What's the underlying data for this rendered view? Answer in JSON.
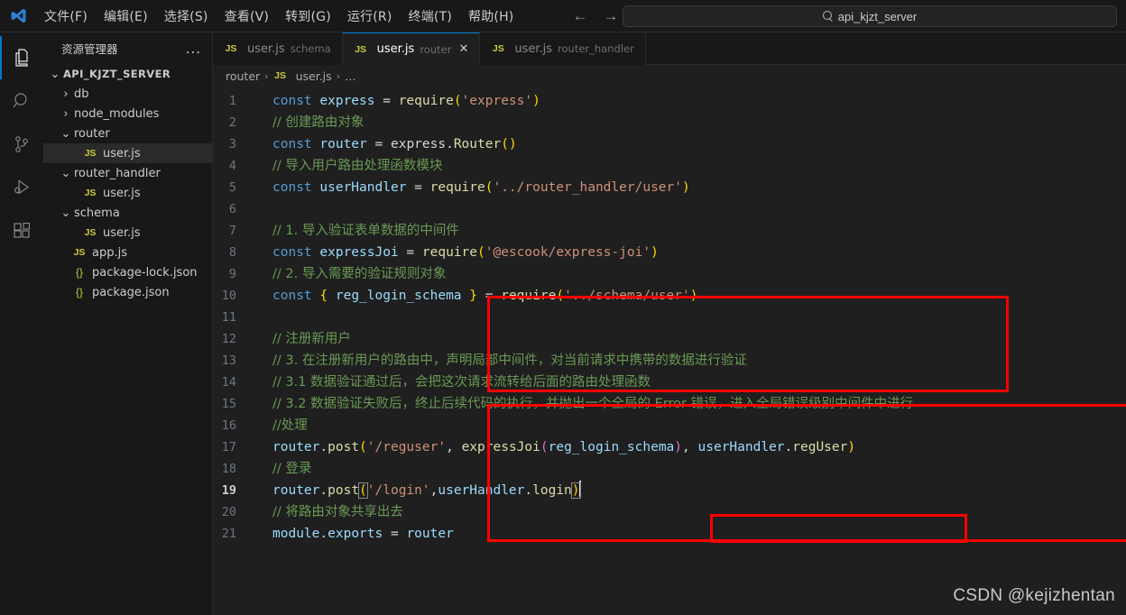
{
  "titlebar": {
    "logo_name": "vscode-logo",
    "menus": [
      "文件(F)",
      "编辑(E)",
      "选择(S)",
      "查看(V)",
      "转到(G)",
      "运行(R)",
      "终端(T)",
      "帮助(H)"
    ],
    "back_arrow": "←",
    "forward_arrow": "→",
    "quick_input": {
      "value": "api_kjzt_server",
      "icon": "search-icon"
    }
  },
  "activitybar": {
    "items": [
      {
        "name": "explorer",
        "active": true
      },
      {
        "name": "search",
        "active": false
      },
      {
        "name": "source-control",
        "active": false
      },
      {
        "name": "run-and-debug",
        "active": false
      },
      {
        "name": "extensions",
        "active": false
      }
    ]
  },
  "sidebar": {
    "title": "资源管理器",
    "more_actions": "...",
    "tree": [
      {
        "label": "API_KJZT_SERVER",
        "type": "root",
        "indent": 0,
        "chevron": "⌄",
        "selected": false
      },
      {
        "label": "db",
        "type": "folder",
        "indent": 1,
        "chevron": "›",
        "selected": false
      },
      {
        "label": "node_modules",
        "type": "folder",
        "indent": 1,
        "chevron": "›",
        "selected": false
      },
      {
        "label": "router",
        "type": "folder",
        "indent": 1,
        "chevron": "⌄",
        "selected": false
      },
      {
        "label": "user.js",
        "type": "js",
        "indent": 2,
        "chevron": "",
        "selected": true
      },
      {
        "label": "router_handler",
        "type": "folder",
        "indent": 1,
        "chevron": "⌄",
        "selected": false
      },
      {
        "label": "user.js",
        "type": "js",
        "indent": 2,
        "chevron": "",
        "selected": false
      },
      {
        "label": "schema",
        "type": "folder",
        "indent": 1,
        "chevron": "⌄",
        "selected": false
      },
      {
        "label": "user.js",
        "type": "js",
        "indent": 2,
        "chevron": "",
        "selected": false
      },
      {
        "label": "app.js",
        "type": "js",
        "indent": 1,
        "chevron": "",
        "selected": false
      },
      {
        "label": "package-lock.json",
        "type": "json",
        "indent": 1,
        "chevron": "",
        "selected": false
      },
      {
        "label": "package.json",
        "type": "json",
        "indent": 1,
        "chevron": "",
        "selected": false
      }
    ]
  },
  "tabs": [
    {
      "icon": "JS",
      "name": "user.js",
      "desc": "schema",
      "active": false,
      "close": ""
    },
    {
      "icon": "JS",
      "name": "user.js",
      "desc": "router",
      "active": true,
      "close": "✕"
    },
    {
      "icon": "JS",
      "name": "user.js",
      "desc": "router_handler",
      "active": false,
      "close": ""
    }
  ],
  "breadcrumb": {
    "folder": "router",
    "file_icon": "JS",
    "file": "user.js",
    "ellipsis": "…",
    "sep": "›"
  },
  "editor": {
    "active_line": 19,
    "lines": [
      {
        "n": 1,
        "tokens": [
          {
            "t": "const ",
            "c": "kw"
          },
          {
            "t": "express",
            "c": "var"
          },
          {
            "t": " = ",
            "c": "plain"
          },
          {
            "t": "require",
            "c": "fn"
          },
          {
            "t": "(",
            "c": "par1"
          },
          {
            "t": "'express'",
            "c": "str"
          },
          {
            "t": ")",
            "c": "par1"
          }
        ]
      },
      {
        "n": 2,
        "tokens": [
          {
            "t": "// 创建路由对象",
            "c": "cmt cmt-cjk"
          }
        ]
      },
      {
        "n": 3,
        "tokens": [
          {
            "t": "const ",
            "c": "kw"
          },
          {
            "t": "router",
            "c": "var"
          },
          {
            "t": " = ",
            "c": "plain"
          },
          {
            "t": "express",
            "c": "plain"
          },
          {
            "t": ".",
            "c": "plain"
          },
          {
            "t": "Router",
            "c": "prop"
          },
          {
            "t": "()",
            "c": "par1"
          }
        ]
      },
      {
        "n": 4,
        "tokens": [
          {
            "t": "// 导入用户路由处理函数模块",
            "c": "cmt cmt-cjk"
          }
        ]
      },
      {
        "n": 5,
        "tokens": [
          {
            "t": "const ",
            "c": "kw"
          },
          {
            "t": "userHandler",
            "c": "var"
          },
          {
            "t": " = ",
            "c": "plain"
          },
          {
            "t": "require",
            "c": "fn"
          },
          {
            "t": "(",
            "c": "par1"
          },
          {
            "t": "'../router_handler/user'",
            "c": "str"
          },
          {
            "t": ")",
            "c": "par1"
          }
        ]
      },
      {
        "n": 6,
        "tokens": []
      },
      {
        "n": 7,
        "tokens": [
          {
            "t": "// 1. 导入验证表单数据的中间件",
            "c": "cmt cmt-cjk"
          }
        ]
      },
      {
        "n": 8,
        "tokens": [
          {
            "t": "const ",
            "c": "kw"
          },
          {
            "t": "expressJoi",
            "c": "var"
          },
          {
            "t": " = ",
            "c": "plain"
          },
          {
            "t": "require",
            "c": "fn"
          },
          {
            "t": "(",
            "c": "par1"
          },
          {
            "t": "'@escook/express-joi'",
            "c": "str"
          },
          {
            "t": ")",
            "c": "par1"
          }
        ]
      },
      {
        "n": 9,
        "tokens": [
          {
            "t": "// 2. 导入需要的验证规则对象",
            "c": "cmt cmt-cjk"
          }
        ]
      },
      {
        "n": 10,
        "tokens": [
          {
            "t": "const ",
            "c": "kw"
          },
          {
            "t": "{ ",
            "c": "par1"
          },
          {
            "t": "reg_login_schema",
            "c": "var"
          },
          {
            "t": " }",
            "c": "par1"
          },
          {
            "t": " = ",
            "c": "plain"
          },
          {
            "t": "require",
            "c": "fn"
          },
          {
            "t": "(",
            "c": "par1"
          },
          {
            "t": "'../schema/user'",
            "c": "str"
          },
          {
            "t": ")",
            "c": "par1"
          }
        ]
      },
      {
        "n": 11,
        "tokens": []
      },
      {
        "n": 12,
        "tokens": [
          {
            "t": "// 注册新用户",
            "c": "cmt cmt-cjk"
          }
        ]
      },
      {
        "n": 13,
        "tokens": [
          {
            "t": "// 3. 在注册新用户的路由中，声明局部中间件，对当前请求中携带的数据进行验证",
            "c": "cmt cmt-cjk"
          }
        ]
      },
      {
        "n": 14,
        "tokens": [
          {
            "t": "// 3.1 数据验证通过后，会把这次请求流转给后面的路由处理函数",
            "c": "cmt cmt-cjk"
          }
        ]
      },
      {
        "n": 15,
        "tokens": [
          {
            "t": "// 3.2 数据验证失败后，终止后续代码的执行，并抛出一个全局的 Error 错误，进入全局错误级别中间件中进行",
            "c": "cmt cmt-cjk"
          }
        ]
      },
      {
        "n": 16,
        "tokens": [
          {
            "t": "//处理",
            "c": "cmt cmt-cjk"
          }
        ]
      },
      {
        "n": 17,
        "tokens": [
          {
            "t": "router",
            "c": "var"
          },
          {
            "t": ".",
            "c": "plain"
          },
          {
            "t": "post",
            "c": "prop"
          },
          {
            "t": "(",
            "c": "par1"
          },
          {
            "t": "'/reguser'",
            "c": "str"
          },
          {
            "t": ", ",
            "c": "plain"
          },
          {
            "t": "expressJoi",
            "c": "fn"
          },
          {
            "t": "(",
            "c": "par2"
          },
          {
            "t": "reg_login_schema",
            "c": "var"
          },
          {
            "t": ")",
            "c": "par2"
          },
          {
            "t": ", ",
            "c": "plain"
          },
          {
            "t": "userHandler",
            "c": "var"
          },
          {
            "t": ".",
            "c": "plain"
          },
          {
            "t": "regUser",
            "c": "prop"
          },
          {
            "t": ")",
            "c": "par1"
          }
        ]
      },
      {
        "n": 18,
        "tokens": [
          {
            "t": "// 登录",
            "c": "cmt cmt-cjk"
          }
        ]
      },
      {
        "n": 19,
        "tokens": [
          {
            "t": "router",
            "c": "var"
          },
          {
            "t": ".",
            "c": "plain"
          },
          {
            "t": "post",
            "c": "prop"
          },
          {
            "t": "(",
            "c": "par1 bracket-box"
          },
          {
            "t": "'/login'",
            "c": "str"
          },
          {
            "t": ",",
            "c": "plain"
          },
          {
            "t": "userHandler",
            "c": "var"
          },
          {
            "t": ".",
            "c": "plain"
          },
          {
            "t": "login",
            "c": "prop"
          },
          {
            "t": ")",
            "c": "par1 bracket-box"
          }
        ]
      },
      {
        "n": 20,
        "tokens": [
          {
            "t": "// 将路由对象共享出去",
            "c": "cmt cmt-cjk"
          }
        ]
      },
      {
        "n": 21,
        "tokens": [
          {
            "t": "module",
            "c": "var"
          },
          {
            "t": ".",
            "c": "plain"
          },
          {
            "t": "exports",
            "c": "var"
          },
          {
            "t": " = ",
            "c": "plain"
          },
          {
            "t": "router",
            "c": "var"
          }
        ]
      }
    ]
  },
  "annotations": {
    "boxes": [
      {
        "id": "redbox-imports",
        "label": "import-middleware-and-schema-highlight",
        "color": "#fe0000"
      },
      {
        "id": "redbox-register",
        "label": "register-route-block-highlight",
        "color": "#fe0000"
      },
      {
        "id": "redbox-joi",
        "label": "express-joi-call-highlight",
        "color": "#fe0000"
      }
    ]
  },
  "watermark": "CSDN @kejizhentan"
}
